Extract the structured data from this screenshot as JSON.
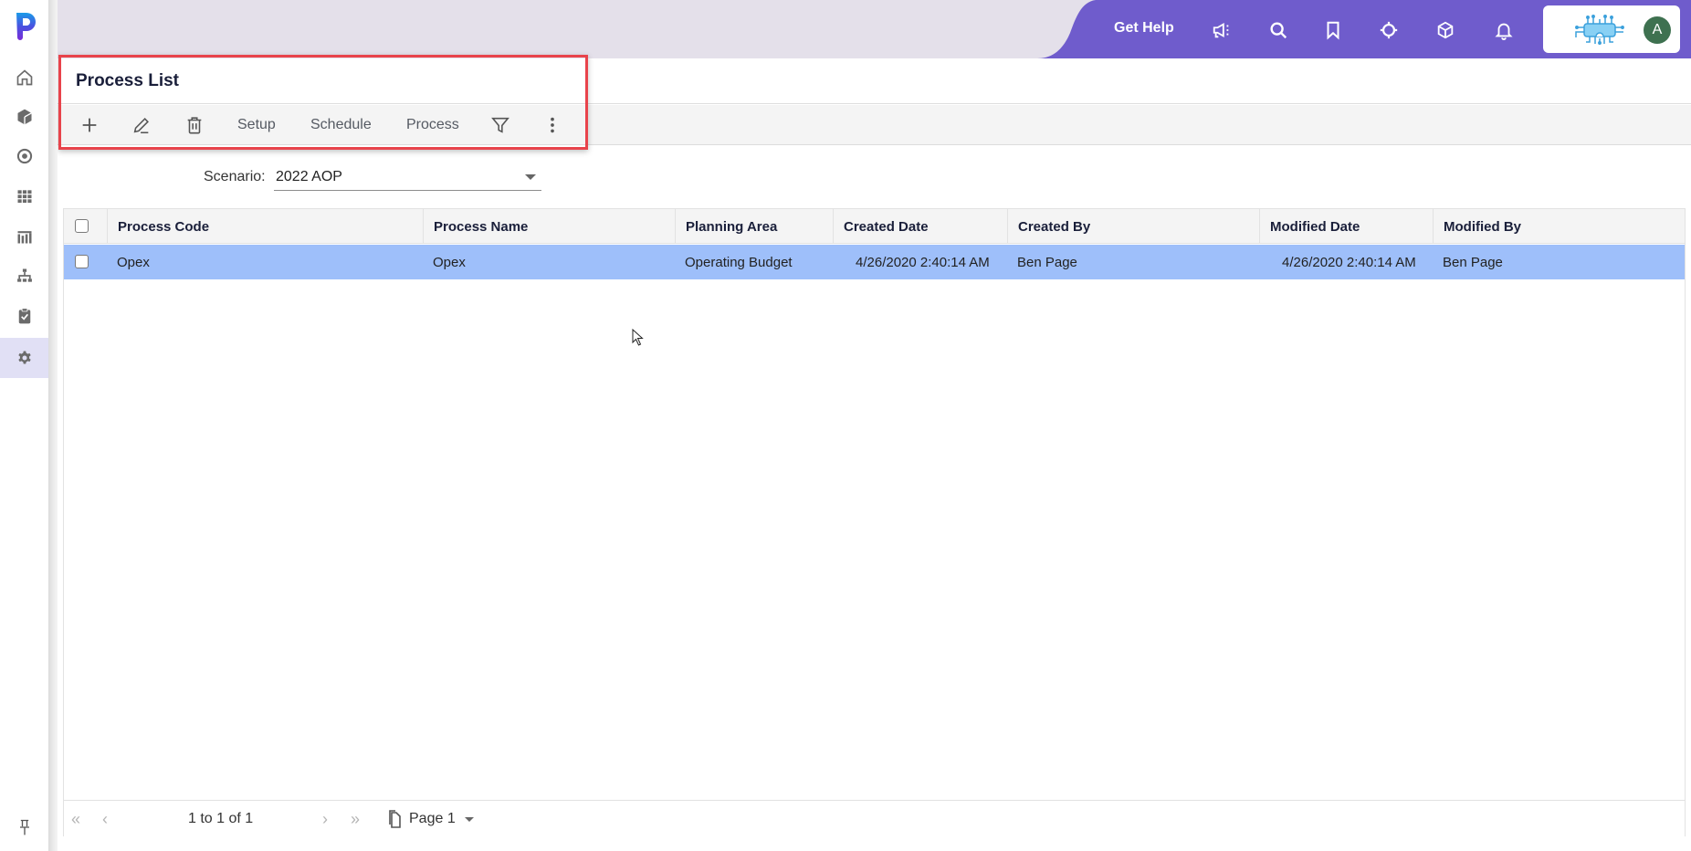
{
  "app": {
    "brand_colors": {
      "accent": "#6f5ccc",
      "selection": "#9ebffa",
      "highlight_border": "#e8434b",
      "avatar": "#3e7150"
    }
  },
  "sidebar": {
    "logo": "p-logo",
    "items": [
      {
        "icon": "home-icon",
        "label": "Home",
        "active": false
      },
      {
        "icon": "cube-icon",
        "label": "Models",
        "active": false
      },
      {
        "icon": "target-icon",
        "label": "Target",
        "active": false
      },
      {
        "icon": "grid-icon",
        "label": "Grid",
        "active": false
      },
      {
        "icon": "chart-icon",
        "label": "Reports",
        "active": false
      },
      {
        "icon": "hierarchy-icon",
        "label": "Hierarchy",
        "active": false
      },
      {
        "icon": "clipboard-check-icon",
        "label": "Tasks",
        "active": false
      },
      {
        "icon": "gear-icon",
        "label": "Settings",
        "active": true
      }
    ],
    "pin_icon": "pin-icon"
  },
  "topbar": {
    "help_label": "Get Help",
    "icons": [
      "megaphone-icon",
      "search-icon",
      "bookmark-icon",
      "crosshair-icon",
      "cube-icon",
      "bell-icon"
    ],
    "user_initial": "A"
  },
  "page": {
    "title": "Process List",
    "toolbar": {
      "add_icon": "plus-icon",
      "edit_icon": "pencil-icon",
      "delete_icon": "trash-icon",
      "setup_label": "Setup",
      "schedule_label": "Schedule",
      "process_label": "Process",
      "filter_icon": "filter-icon",
      "more_icon": "kebab-icon"
    },
    "scenario": {
      "label": "Scenario:",
      "value": "2022 AOP"
    }
  },
  "grid": {
    "columns": [
      "Process Code",
      "Process Name",
      "Planning Area",
      "Created Date",
      "Created By",
      "Modified Date",
      "Modified By"
    ],
    "rows": [
      {
        "selected": true,
        "checked": false,
        "cells": [
          "Opex",
          "Opex",
          "Operating Budget",
          "4/26/2020 2:40:14 AM",
          "Ben Page",
          "4/26/2020 2:40:14 AM",
          "Ben Page"
        ]
      }
    ],
    "pager": {
      "summary": "1 to 1 of 1",
      "page_label": "Page 1"
    }
  }
}
